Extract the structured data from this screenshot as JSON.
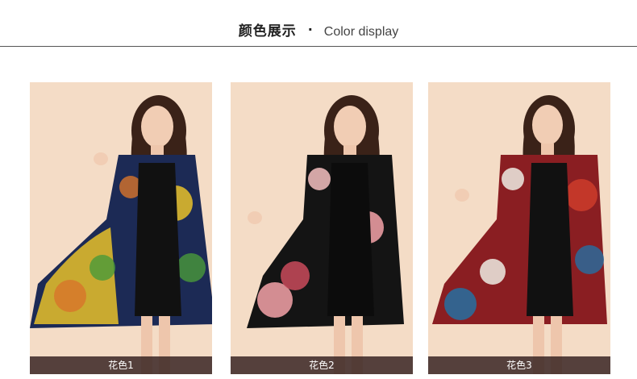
{
  "header": {
    "title_cn": "颜色展示",
    "separator": "·",
    "title_en": "Color display"
  },
  "products": [
    {
      "label": "花色1",
      "pattern_colors": [
        "#1c2a55",
        "#e8c12a",
        "#4a9a3a",
        "#d8742a",
        "#2a4a88"
      ]
    },
    {
      "label": "花色2",
      "pattern_colors": [
        "#141414",
        "#e89aa0",
        "#c94a5a",
        "#4a8a4a",
        "#f4c0c0"
      ]
    },
    {
      "label": "花色3",
      "pattern_colors": [
        "#8a1e22",
        "#2a6a9a",
        "#e8e0d8",
        "#c93a2a",
        "#3a3a5a"
      ]
    }
  ],
  "colors": {
    "background_warm": "#f4dcc6",
    "label_bar": "#281414",
    "divider": "#555555"
  }
}
